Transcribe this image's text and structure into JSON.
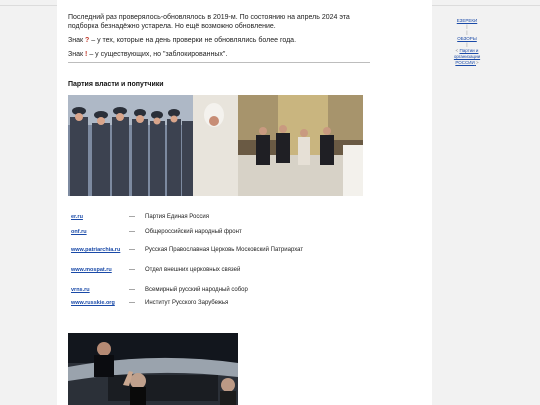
{
  "intro": {
    "line1": "Последний раз проверялось-обновлялось в 2019-м. По состоянию на апрель 2024 эта подборка безнадёжно устарела. Но ещё возможно обновление.",
    "line2_prefix": "Знак",
    "line2_mark": "?",
    "line2_rest": "– у тех, которые на день проверки не обновлялись более года.",
    "line3_prefix": "Знак",
    "line3_mark": "!",
    "line3_rest": "– у существующих, но \"заблокированных\"."
  },
  "section": {
    "title": "Партия власти и попутчики"
  },
  "links": [
    {
      "link": "er.ru",
      "dash": "—",
      "desc": "Партия Единая Россия"
    },
    {
      "link": "onf.ru",
      "dash": "—",
      "desc": "Общероссийский народный фронт"
    },
    {
      "link": "www.patriarchia.ru",
      "dash": "—",
      "desc": "Русская Православная Церковь Московский Патриархат"
    },
    {
      "link": "www.mospat.ru",
      "dash": "—",
      "desc": "Отдел внешних церковных связей"
    },
    {
      "link": "vrns.ru",
      "dash": "—",
      "desc": "Всемирный русский народный собор"
    },
    {
      "link": "www.russkie.org",
      "dash": "—",
      "desc": "Институт Русского Зарубежья"
    }
  ],
  "sidebar": {
    "item1": "ЕЗЕРЕКИ",
    "sep": "|",
    "item2": "ОБЗОРЫ",
    "item3_a": "Партии и",
    "item3_b": "организации",
    "item3_c": "РОССИИ",
    "arrow_left": "<",
    "arrow_right": ">"
  }
}
